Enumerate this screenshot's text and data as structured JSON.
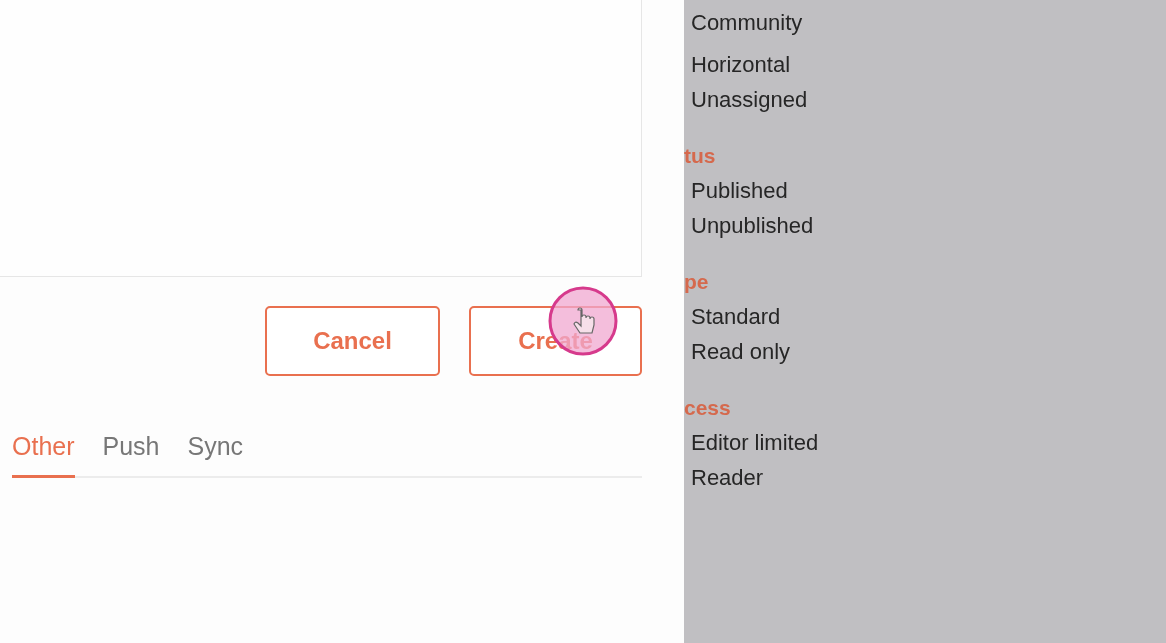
{
  "dialog": {
    "buttons": [
      {
        "label": "Cancel"
      },
      {
        "label": "Create"
      }
    ]
  },
  "tabs": [
    {
      "label": "Other",
      "selected": true
    },
    {
      "label": "Push",
      "selected": false
    },
    {
      "label": "Sync",
      "selected": false
    }
  ],
  "filter_panel": {
    "groups": [
      {
        "items": [
          "Community",
          "Horizontal",
          "Unassigned"
        ]
      },
      {
        "heading": "tus",
        "items": [
          "Published",
          "Unpublished"
        ]
      },
      {
        "heading": "pe",
        "items": [
          "Standard",
          "Read only"
        ]
      },
      {
        "heading": "cess",
        "items": [
          "Editor limited",
          "Reader"
        ]
      }
    ]
  }
}
